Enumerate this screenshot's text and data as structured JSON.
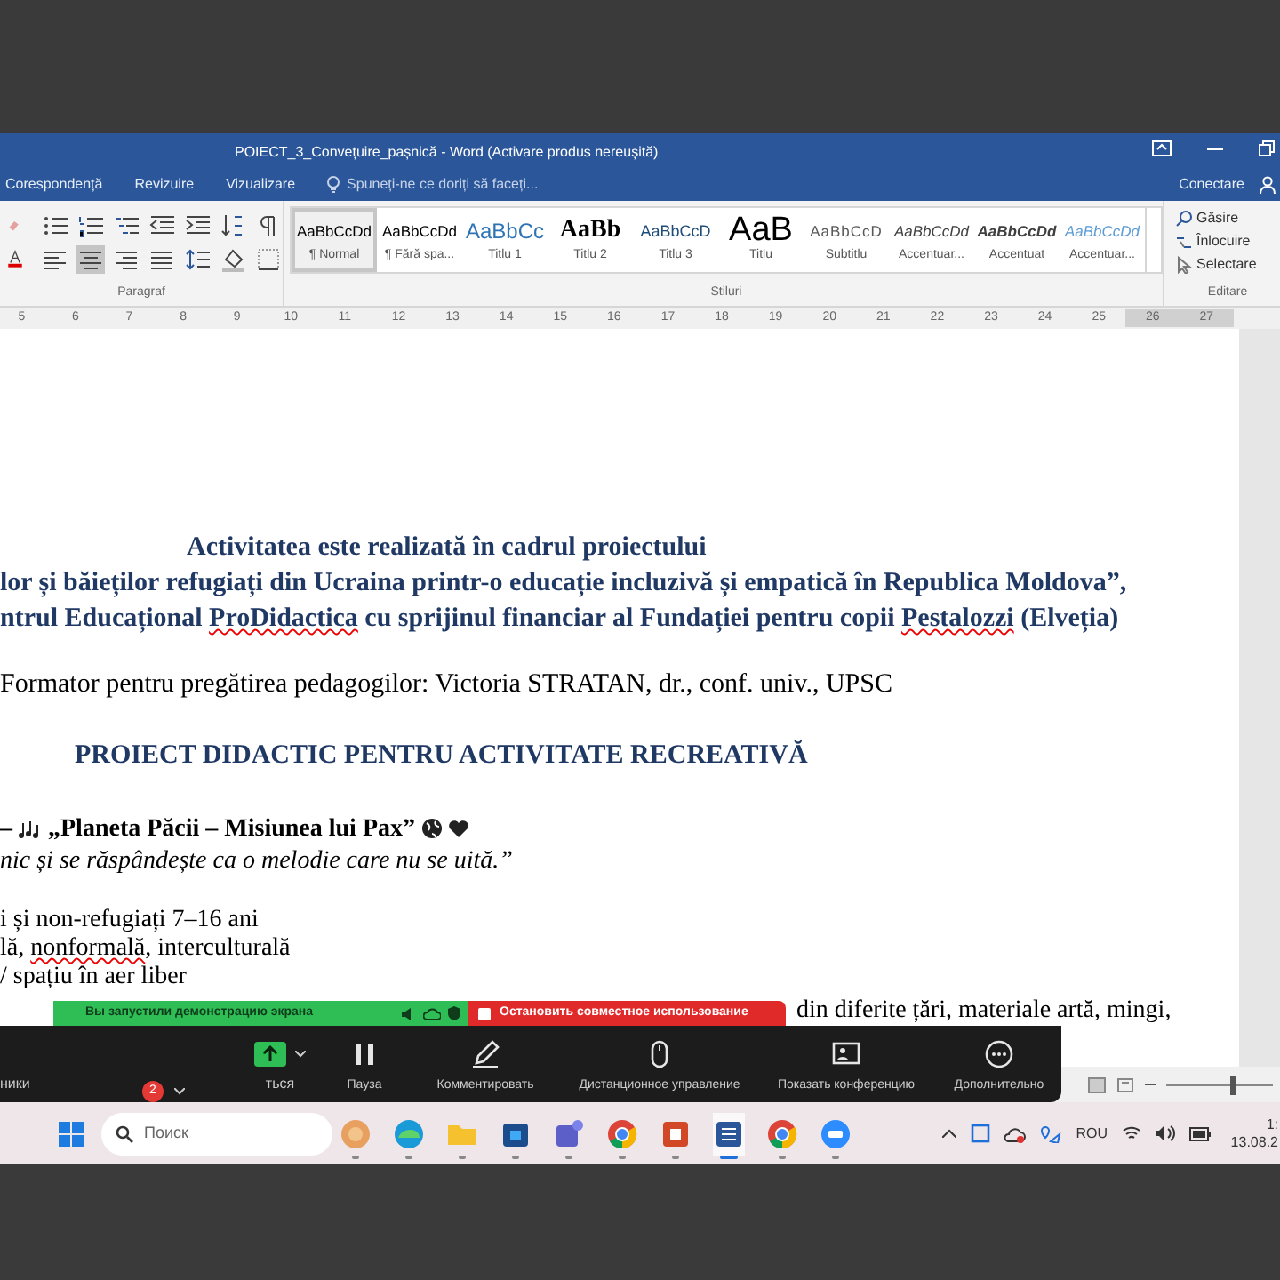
{
  "title_bar": {
    "title": "POIECT_3_Convețuire_pașnică - Word (Activare produs nereușită)"
  },
  "ribbon_tabs": [
    "Corespondență",
    "Revizuire",
    "Vizualizare"
  ],
  "tell_me": {
    "placeholder": "Spuneți-ne ce doriți să faceți..."
  },
  "sign_in": "Conectare",
  "paragraph_group": {
    "label": "Paragraf",
    "rows": [
      [
        {
          "kind": "bullets",
          "selected": false
        },
        {
          "kind": "numbering",
          "selected": false
        },
        {
          "kind": "multilevel",
          "selected": false
        },
        {
          "kind": "outdent",
          "selected": false
        },
        {
          "kind": "indent",
          "selected": false
        },
        {
          "kind": "sort",
          "selected": false
        },
        {
          "kind": "pilcrow",
          "selected": false
        }
      ],
      [
        {
          "kind": "align-left",
          "selected": false
        },
        {
          "kind": "align-center",
          "selected": true
        },
        {
          "kind": "align-right",
          "selected": false
        },
        {
          "kind": "justify",
          "selected": false
        },
        {
          "kind": "line-spacing",
          "selected": false
        },
        {
          "kind": "shading",
          "selected": false
        },
        {
          "kind": "borders",
          "selected": false
        }
      ]
    ]
  },
  "styles_group": {
    "label": "Stiluri",
    "styles": [
      {
        "preview": "AaBbCcDd",
        "name": "¶ Normal",
        "kind": "normal",
        "selected": true
      },
      {
        "preview": "AaBbCcDd",
        "name": "¶ Fără spa...",
        "kind": "normal",
        "selected": false
      },
      {
        "preview": "AaBbCc",
        "name": "Titlu 1",
        "kind": "heading1",
        "selected": false
      },
      {
        "preview": "AaBb",
        "name": "Titlu 2",
        "kind": "heading2",
        "selected": false
      },
      {
        "preview": "AaBbCcD",
        "name": "Titlu 3",
        "kind": "heading3",
        "selected": false
      },
      {
        "preview": "AaB",
        "name": "Titlu",
        "kind": "title",
        "selected": false
      },
      {
        "preview": "AaBbCcD",
        "name": "Subtitlu",
        "kind": "subtitle",
        "selected": false
      },
      {
        "preview": "AaBbCcDd",
        "name": "Accentuar...",
        "kind": "subtle",
        "selected": false
      },
      {
        "preview": "AaBbCcDd",
        "name": "Accentuat",
        "kind": "strong",
        "selected": false
      },
      {
        "preview": "AaBbCcDd",
        "name": "Accentuar...",
        "kind": "intense",
        "selected": false
      }
    ]
  },
  "editing_group": {
    "label": "Editare",
    "items": [
      {
        "kind": "find",
        "label": "Găsire"
      },
      {
        "kind": "replace",
        "label": "Înlocuire"
      },
      {
        "kind": "select",
        "label": "Selectare"
      }
    ]
  },
  "ruler": [
    "5",
    "6",
    "7",
    "8",
    "9",
    "10",
    "11",
    "12",
    "13",
    "14",
    "15",
    "16",
    "17",
    "18",
    "19",
    "20",
    "21",
    "22",
    "23",
    "24",
    "25",
    "26",
    "27"
  ],
  "document": {
    "lines": [
      {
        "kind": "project-heading",
        "segments": [
          {
            "text": "Activitatea este realizată în cadrul proiectului",
            "misspelled": false
          }
        ]
      },
      {
        "kind": "project-line",
        "segments": [
          {
            "text": "lor și băieților refugiați din Ucraina printr-o educație incluzivă și empatică în Republica Moldova”,",
            "misspelled": false
          }
        ]
      },
      {
        "kind": "project-line",
        "segments": [
          {
            "text": "ntrul Educațional ",
            "misspelled": false
          },
          {
            "text": "ProDidactica",
            "misspelled": true
          },
          {
            "text": " cu sprijinul financiar al Fundației pentru copii ",
            "misspelled": false
          },
          {
            "text": "Pestalozzi",
            "misspelled": true
          },
          {
            "text": " (Elveția)",
            "misspelled": false
          }
        ]
      },
      {
        "kind": "trainer",
        "segments": [
          {
            "text": "Formator pentru pregătirea pedagogilor: Victoria STRATAN, dr., conf. univ., UPSC",
            "misspelled": false
          }
        ]
      },
      {
        "kind": "title",
        "segments": [
          {
            "text": "PROIECT DIDACTIC PENTRU ACTIVITATE RECREATIVĂ",
            "misspelled": false
          }
        ]
      },
      {
        "kind": "activity",
        "dash": "–",
        "title": "„Planeta Păcii – Misiunea lui Pax”"
      },
      {
        "kind": "motto",
        "segments": [
          {
            "text": "nic și se răspândește ca o melodie care nu se uită.”",
            "misspelled": false
          }
        ]
      },
      {
        "kind": "body",
        "segments": [
          {
            "text": "i și non-refugiați 7–16 ani",
            "misspelled": false
          }
        ]
      },
      {
        "kind": "body",
        "segments": [
          {
            "text": "lă, ",
            "misspelled": false
          },
          {
            "text": "nonformală",
            "misspelled": true
          },
          {
            "text": ", interculturală",
            "misspelled": false
          }
        ]
      },
      {
        "kind": "body",
        "segments": [
          {
            "text": "/ spațiu în aer liber",
            "misspelled": false
          }
        ]
      },
      {
        "kind": "body-right",
        "segments": [
          {
            "text": "din diferite țări, materiale artă, mingi,",
            "misspelled": false
          }
        ]
      }
    ]
  },
  "share_banner": {
    "status": "Вы запустили демонстрацию экрана",
    "stop": "Остановить совместное использование"
  },
  "meeting_toolbar": [
    {
      "kind": "text",
      "label": "ники"
    },
    {
      "kind": "badge",
      "badge": "2"
    },
    {
      "kind": "share",
      "label": "ться"
    },
    {
      "kind": "pause",
      "label": "Пауза"
    },
    {
      "kind": "annotate",
      "label": "Комментировать"
    },
    {
      "kind": "remote",
      "label": "Дистанционное управление"
    },
    {
      "kind": "meeting",
      "label": "Показать конференцию"
    },
    {
      "kind": "more",
      "label": "Дополнительно"
    }
  ],
  "zoom_slider": {
    "level": 0.62
  },
  "taskbar": {
    "search": {
      "placeholder": "Поиск"
    },
    "apps": [
      {
        "kind": "photos",
        "active": false
      },
      {
        "kind": "edge",
        "active": false
      },
      {
        "kind": "folder",
        "active": false
      },
      {
        "kind": "store",
        "active": false
      },
      {
        "kind": "teams",
        "active": false
      },
      {
        "kind": "chrome",
        "active": false
      },
      {
        "kind": "powerpoint",
        "active": false
      },
      {
        "kind": "word",
        "active": true
      },
      {
        "kind": "chrome",
        "active": false
      },
      {
        "kind": "circle",
        "active": false
      }
    ],
    "language": "ROU",
    "time": "1:",
    "date": "13.08.2"
  }
}
